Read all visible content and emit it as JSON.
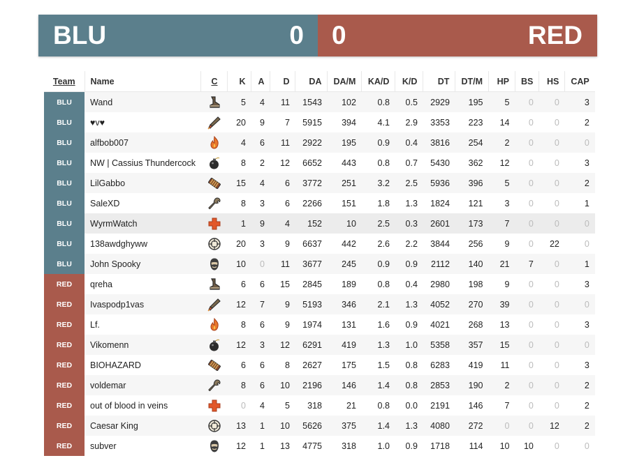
{
  "scoreboard": {
    "blu": {
      "name": "BLU",
      "score": "0",
      "color": "#5b7f8c"
    },
    "red": {
      "name": "RED",
      "score": "0",
      "color": "#a95a4c"
    }
  },
  "headers": [
    "Team",
    "Name",
    "C",
    "K",
    "A",
    "D",
    "DA",
    "DA/M",
    "KA/D",
    "K/D",
    "DT",
    "DT/M",
    "HP",
    "BS",
    "HS",
    "CAP"
  ],
  "players": [
    {
      "team": "BLU",
      "name": "Wand",
      "class": "scout-icon",
      "k": "5",
      "a": "4",
      "d": "11",
      "da": "1543",
      "dam": "102",
      "kad": "0.8",
      "kd": "0.5",
      "dt": "2929",
      "dtm": "195",
      "hp": "5",
      "bs": "0",
      "hs": "0",
      "cap": "3"
    },
    {
      "team": "BLU",
      "name": "♥v♥",
      "class": "soldier-icon",
      "k": "20",
      "a": "9",
      "d": "7",
      "da": "5915",
      "dam": "394",
      "kad": "4.1",
      "kd": "2.9",
      "dt": "3353",
      "dtm": "223",
      "hp": "14",
      "bs": "0",
      "hs": "0",
      "cap": "2"
    },
    {
      "team": "BLU",
      "name": "alfbob007",
      "class": "pyro-icon",
      "k": "4",
      "a": "6",
      "d": "11",
      "da": "2922",
      "dam": "195",
      "kad": "0.9",
      "kd": "0.4",
      "dt": "3816",
      "dtm": "254",
      "hp": "2",
      "bs": "0",
      "hs": "0",
      "cap": "0"
    },
    {
      "team": "BLU",
      "name": "NW | Cassius Thundercock",
      "class": "demoman-icon",
      "k": "8",
      "a": "2",
      "d": "12",
      "da": "6652",
      "dam": "443",
      "kad": "0.8",
      "kd": "0.7",
      "dt": "5430",
      "dtm": "362",
      "hp": "12",
      "bs": "0",
      "hs": "0",
      "cap": "3"
    },
    {
      "team": "BLU",
      "name": "LilGabbo",
      "class": "heavy-icon",
      "k": "15",
      "a": "4",
      "d": "6",
      "da": "3772",
      "dam": "251",
      "kad": "3.2",
      "kd": "2.5",
      "dt": "5936",
      "dtm": "396",
      "hp": "5",
      "bs": "0",
      "hs": "0",
      "cap": "2"
    },
    {
      "team": "BLU",
      "name": "SaleXD",
      "class": "engineer-icon",
      "k": "8",
      "a": "3",
      "d": "6",
      "da": "2266",
      "dam": "151",
      "kad": "1.8",
      "kd": "1.3",
      "dt": "1824",
      "dtm": "121",
      "hp": "3",
      "bs": "0",
      "hs": "0",
      "cap": "1"
    },
    {
      "team": "BLU",
      "name": "WyrmWatch",
      "class": "medic-icon",
      "k": "1",
      "a": "9",
      "d": "4",
      "da": "152",
      "dam": "10",
      "kad": "2.5",
      "kd": "0.3",
      "dt": "2601",
      "dtm": "173",
      "hp": "7",
      "bs": "0",
      "hs": "0",
      "cap": "0",
      "highlight": true
    },
    {
      "team": "BLU",
      "name": "138awdghyww",
      "class": "sniper-icon",
      "k": "20",
      "a": "3",
      "d": "9",
      "da": "6637",
      "dam": "442",
      "kad": "2.6",
      "kd": "2.2",
      "dt": "3844",
      "dtm": "256",
      "hp": "9",
      "bs": "0",
      "hs": "22",
      "cap": "0"
    },
    {
      "team": "BLU",
      "name": "John Spooky",
      "class": "spy-icon",
      "k": "10",
      "a": "0",
      "d": "11",
      "da": "3677",
      "dam": "245",
      "kad": "0.9",
      "kd": "0.9",
      "dt": "2112",
      "dtm": "140",
      "hp": "21",
      "bs": "7",
      "hs": "0",
      "cap": "1"
    },
    {
      "team": "RED",
      "name": "qreha",
      "class": "scout-icon",
      "k": "6",
      "a": "6",
      "d": "15",
      "da": "2845",
      "dam": "189",
      "kad": "0.8",
      "kd": "0.4",
      "dt": "2980",
      "dtm": "198",
      "hp": "9",
      "bs": "0",
      "hs": "0",
      "cap": "3"
    },
    {
      "team": "RED",
      "name": "Ivaspodp1vas",
      "class": "soldier-icon",
      "k": "12",
      "a": "7",
      "d": "9",
      "da": "5193",
      "dam": "346",
      "kad": "2.1",
      "kd": "1.3",
      "dt": "4052",
      "dtm": "270",
      "hp": "39",
      "bs": "0",
      "hs": "0",
      "cap": "0"
    },
    {
      "team": "RED",
      "name": "Lf.",
      "class": "pyro-icon",
      "k": "8",
      "a": "6",
      "d": "9",
      "da": "1974",
      "dam": "131",
      "kad": "1.6",
      "kd": "0.9",
      "dt": "4021",
      "dtm": "268",
      "hp": "13",
      "bs": "0",
      "hs": "0",
      "cap": "3"
    },
    {
      "team": "RED",
      "name": "Vikomenn",
      "class": "demoman-icon",
      "k": "12",
      "a": "3",
      "d": "12",
      "da": "6291",
      "dam": "419",
      "kad": "1.3",
      "kd": "1.0",
      "dt": "5358",
      "dtm": "357",
      "hp": "15",
      "bs": "0",
      "hs": "0",
      "cap": "0"
    },
    {
      "team": "RED",
      "name": "BIOHAZARD",
      "class": "heavy-icon",
      "k": "6",
      "a": "6",
      "d": "8",
      "da": "2627",
      "dam": "175",
      "kad": "1.5",
      "kd": "0.8",
      "dt": "6283",
      "dtm": "419",
      "hp": "11",
      "bs": "0",
      "hs": "0",
      "cap": "3"
    },
    {
      "team": "RED",
      "name": "voldemar",
      "class": "engineer-icon",
      "k": "8",
      "a": "6",
      "d": "10",
      "da": "2196",
      "dam": "146",
      "kad": "1.4",
      "kd": "0.8",
      "dt": "2853",
      "dtm": "190",
      "hp": "2",
      "bs": "0",
      "hs": "0",
      "cap": "2"
    },
    {
      "team": "RED",
      "name": "out of blood in veins",
      "class": "medic-icon",
      "k": "0",
      "a": "4",
      "d": "5",
      "da": "318",
      "dam": "21",
      "kad": "0.8",
      "kd": "0.0",
      "dt": "2191",
      "dtm": "146",
      "hp": "7",
      "bs": "0",
      "hs": "0",
      "cap": "2"
    },
    {
      "team": "RED",
      "name": "Caesar King",
      "class": "sniper-icon",
      "k": "13",
      "a": "1",
      "d": "10",
      "da": "5626",
      "dam": "375",
      "kad": "1.4",
      "kd": "1.3",
      "dt": "4080",
      "dtm": "272",
      "hp": "0",
      "bs": "0",
      "hs": "12",
      "cap": "2"
    },
    {
      "team": "RED",
      "name": "subver",
      "class": "spy-icon",
      "k": "12",
      "a": "1",
      "d": "13",
      "da": "4775",
      "dam": "318",
      "kad": "1.0",
      "kd": "0.9",
      "dt": "1718",
      "dtm": "114",
      "hp": "10",
      "bs": "10",
      "hs": "0",
      "cap": "0"
    }
  ]
}
